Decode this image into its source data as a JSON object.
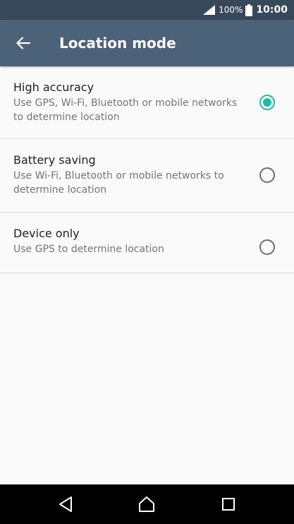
{
  "status_bar": {
    "battery_percent": "100%",
    "time": "10:00",
    "icons": [
      "signal-icon",
      "battery-icon"
    ]
  },
  "app_bar": {
    "title": "Location mode",
    "back_icon": "arrow-left-icon"
  },
  "options": [
    {
      "title": "High accuracy",
      "description": "Use GPS, Wi-Fi, Bluetooth or mobile networks to determine location",
      "selected": true
    },
    {
      "title": "Battery saving",
      "description": "Use Wi-Fi, Bluetooth or mobile networks to determine location",
      "selected": false
    },
    {
      "title": "Device only",
      "description": "Use GPS to determine location",
      "selected": false
    }
  ],
  "nav_bar": {
    "icons": [
      "back-triangle-icon",
      "home-icon",
      "recents-icon"
    ]
  },
  "colors": {
    "status_bar_bg": "#36485a",
    "app_bar_bg": "#4b6278",
    "accent": "#1fbdac",
    "background": "#fafafa"
  }
}
